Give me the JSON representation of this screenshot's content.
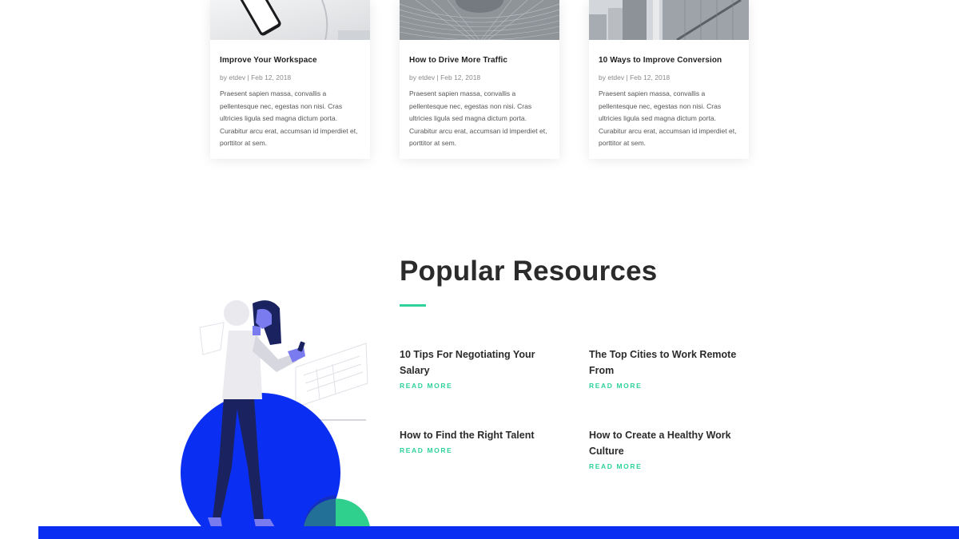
{
  "blog_posts": [
    {
      "title": "Improve Your Workspace",
      "meta": "by etdev | Feb 12, 2018",
      "excerpt": "Praesent sapien massa, convallis a pellentesque nec, egestas non nisi. Cras ultricies ligula sed magna dictum porta. Curabitur arcu erat, accumsan id imperdiet et, porttitor at sem.",
      "image": "phone-on-desk-photo"
    },
    {
      "title": "How to Drive More Traffic",
      "meta": "by etdev | Feb 12, 2018",
      "excerpt": "Praesent sapien massa, convallis a pellentesque nec, egestas non nisi. Cras ultricies ligula sed magna dictum porta. Curabitur arcu erat, accumsan id imperdiet et, porttitor at sem.",
      "image": "abstract-web-photo"
    },
    {
      "title": "10 Ways to Improve Conversion",
      "meta": "by etdev | Feb 12, 2018",
      "excerpt": "Praesent sapien massa, convallis a pellentesque nec, egestas non nisi. Cras ultricies ligula sed magna dictum porta. Curabitur arcu erat, accumsan id imperdiet et, porttitor at sem.",
      "image": "city-buildings-photo"
    }
  ],
  "popular_resources": {
    "title": "Popular Resources",
    "link_label": "READ MORE",
    "items": [
      {
        "title": "10 Tips For Negotiating Your Salary"
      },
      {
        "title": "The Top Cities to Work Remote From"
      },
      {
        "title": "How to Find the Right Talent"
      },
      {
        "title": "How to Create a Healthy Work Culture"
      }
    ]
  },
  "colors": {
    "accent_green": "#2ed29a",
    "brand_blue": "#0b2ff2",
    "illustration_purple": "#6f6ff2",
    "navy": "#1a2260"
  }
}
